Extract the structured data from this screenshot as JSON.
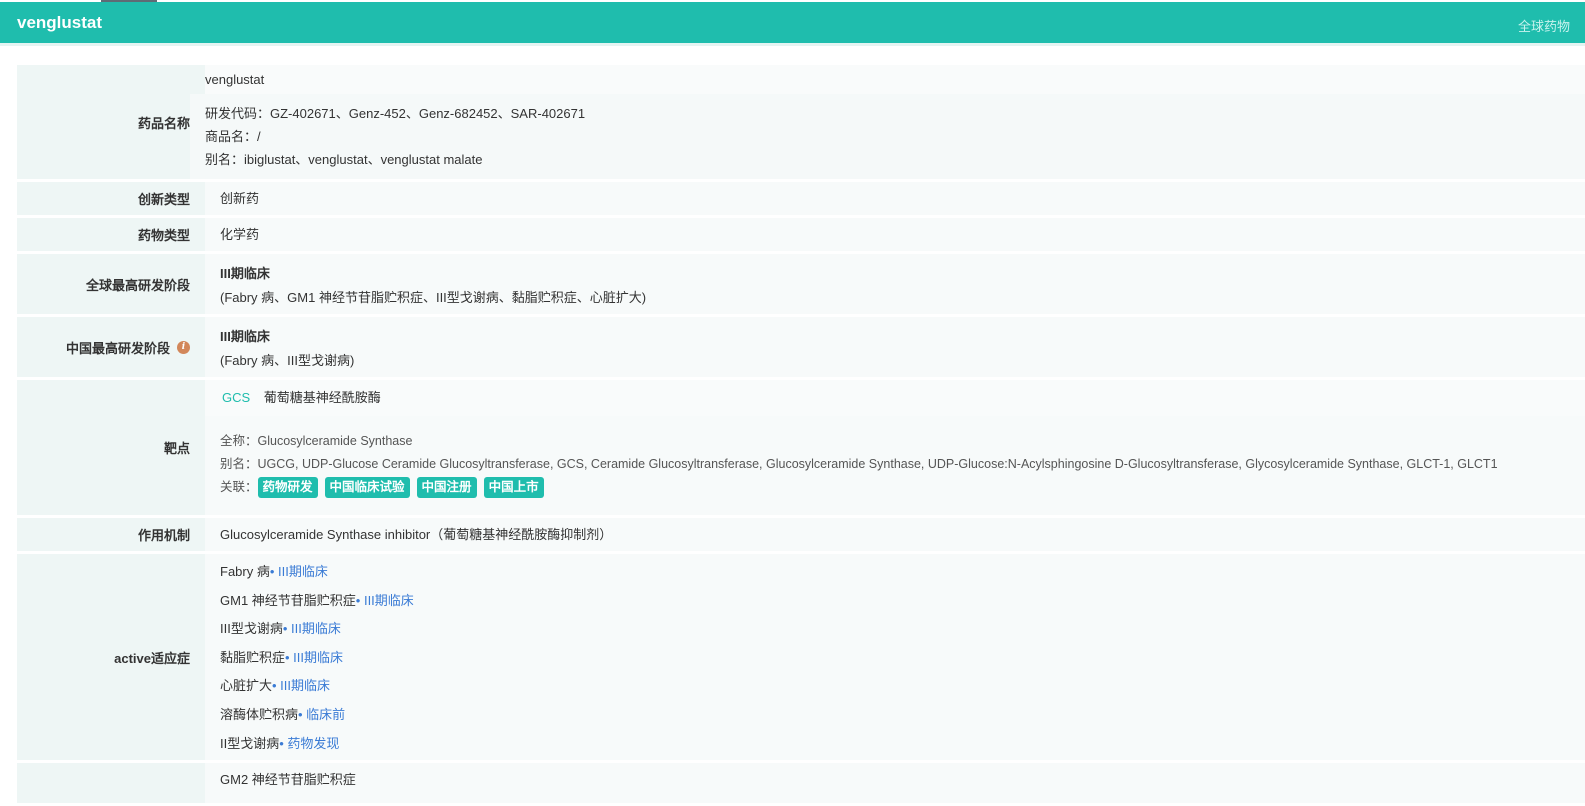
{
  "header": {
    "title": "venglustat",
    "right_link": "全球药物"
  },
  "drug_name": {
    "label": "药品名称",
    "name": "venglustat",
    "code": "研发代码：GZ-402671、Genz-452、Genz-682452、SAR-402671",
    "trade": "商品名：/",
    "alias": "别名：ibiglustat、venglustat、venglustat malate"
  },
  "innovation": {
    "label": "创新类型",
    "value": "创新药"
  },
  "drug_type": {
    "label": "药物类型",
    "value": "化学药"
  },
  "global_stage": {
    "label": "全球最高研发阶段",
    "stage": "III期临床",
    "detail": "(Fabry 病、GM1 神经节苷脂贮积症、III型戈谢病、黏脂贮积症、心脏扩大)"
  },
  "china_stage": {
    "label": "中国最高研发阶段",
    "info_icon": "i",
    "stage": "III期临床",
    "detail": "(Fabry 病、III型戈谢病)"
  },
  "target": {
    "label": "靶点",
    "code": "GCS",
    "cn_name": "葡萄糖基神经酰胺酶",
    "full_name": "全称：Glucosylceramide Synthase",
    "alias": "别名：UGCG, UDP-Glucose Ceramide Glucosyltransferase, GCS, Ceramide Glucosyltransferase, Glucosylceramide Synthase, UDP-Glucose:N-Acylsphingosine D-Glucosyltransferase, Glycosylceramide Synthase, GLCT-1, GLCT1",
    "related_label": "关联：",
    "tags": [
      "药物研发",
      "中国临床试验",
      "中国注册",
      "中国上市"
    ]
  },
  "mechanism": {
    "label": "作用机制",
    "value": "Glucosylceramide Synthase inhibitor（葡萄糖基神经酰胺酶抑制剂）"
  },
  "indications": {
    "label": "active适应症",
    "items": [
      {
        "name": "Fabry 病",
        "stage": "• III期临床"
      },
      {
        "name": "GM1 神经节苷脂贮积症",
        "stage": "• III期临床"
      },
      {
        "name": "III型戈谢病",
        "stage": "• III期临床"
      },
      {
        "name": "黏脂贮积症",
        "stage": "• III期临床"
      },
      {
        "name": "心脏扩大",
        "stage": "• III期临床"
      },
      {
        "name": "溶酶体贮积病",
        "stage": "• 临床前"
      },
      {
        "name": "II型戈谢病",
        "stage": "• 药物发现"
      }
    ]
  },
  "next_row": {
    "value": "GM2 神经节苷脂贮积症"
  }
}
